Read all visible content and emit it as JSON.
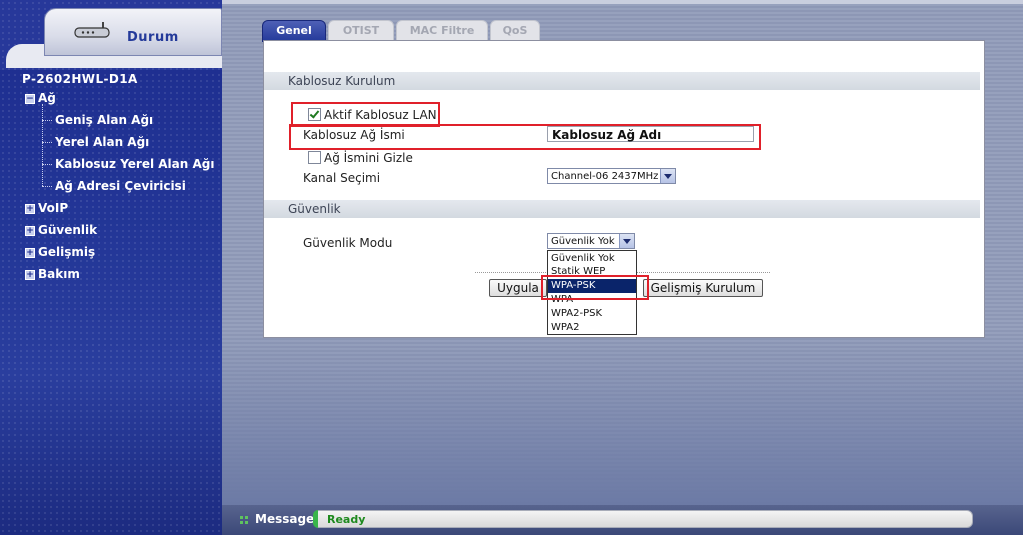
{
  "sidebar": {
    "top_tab_label": "Durum",
    "device_name": "P-2602HWL-D1A",
    "nav": [
      {
        "label": "Ağ",
        "expand": "−"
      },
      {
        "label": "VoIP",
        "expand": "+"
      },
      {
        "label": "Güvenlik",
        "expand": "+"
      },
      {
        "label": "Gelişmiş",
        "expand": "+"
      },
      {
        "label": "Bakım",
        "expand": "+"
      }
    ],
    "sub_items": [
      "Geniş Alan Ağı",
      "Yerel Alan Ağı",
      "Kablosuz Yerel Alan Ağı",
      "Ağ Adresi Çeviricisi"
    ]
  },
  "tabs": [
    "Genel",
    "OTIST",
    "MAC Filtre",
    "QoS"
  ],
  "wireless": {
    "section_title": "Kablosuz Kurulum",
    "active_label": "Aktif Kablosuz LAN",
    "active_checked": true,
    "ssid_label": "Kablosuz Ağ İsmi",
    "ssid_value": "Kablosuz Ağ Adı",
    "hide_ssid_label": "Ağ İsmini Gizle",
    "hide_ssid_checked": false,
    "channel_label": "Kanal Seçimi",
    "channel_value": "Channel-06 2437MHz"
  },
  "security": {
    "section_title": "Güvenlik",
    "mode_label": "Güvenlik Modu",
    "mode_value": "Güvenlik Yok",
    "options": [
      "Güvenlik Yok",
      "Statik WEP",
      "WPA-PSK",
      "WPA",
      "WPA2-PSK",
      "WPA2"
    ],
    "highlighted_option": "WPA-PSK"
  },
  "buttons": {
    "apply": "Uygula",
    "advanced": "Gelişmiş Kurulum"
  },
  "status": {
    "label": "Message",
    "value": "Ready"
  },
  "colors": {
    "sidebar_blue": "#223596",
    "highlight_red": "#e0202a",
    "status_green": "#1e8a1e"
  }
}
